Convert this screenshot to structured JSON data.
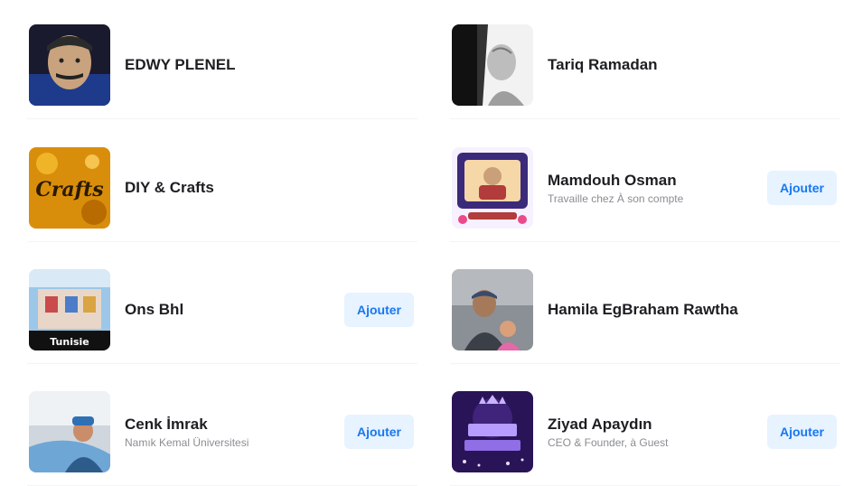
{
  "suggestions": [
    {
      "name": "EDWY PLENEL",
      "subtitle": "",
      "action": ""
    },
    {
      "name": "Tariq Ramadan",
      "subtitle": "",
      "action": ""
    },
    {
      "name": "DIY & Crafts",
      "subtitle": "",
      "action": ""
    },
    {
      "name": "Mamdouh Osman",
      "subtitle": "Travaille chez À son compte",
      "action": "Ajouter"
    },
    {
      "name": "Ons Bhl",
      "subtitle": "",
      "action": "Ajouter"
    },
    {
      "name": "Hamila EgBraham Rawtha",
      "subtitle": "",
      "action": ""
    },
    {
      "name": "Cenk İmrak",
      "subtitle": "Namık Kemal Üniversitesi",
      "action": "Ajouter"
    },
    {
      "name": "Ziyad Apaydın",
      "subtitle": "CEO & Founder, à Guest",
      "action": "Ajouter"
    }
  ],
  "thumbs": {
    "crafts_logo_text": "Crafts",
    "ons_caption": "Tunisie"
  },
  "colors": {
    "button_bg": "#e7f3ff",
    "button_text": "#1877f2",
    "name_text": "#1c1e21",
    "sub_text": "#8a8d91"
  },
  "icons": [
    "profile-photo",
    "page-logo"
  ]
}
